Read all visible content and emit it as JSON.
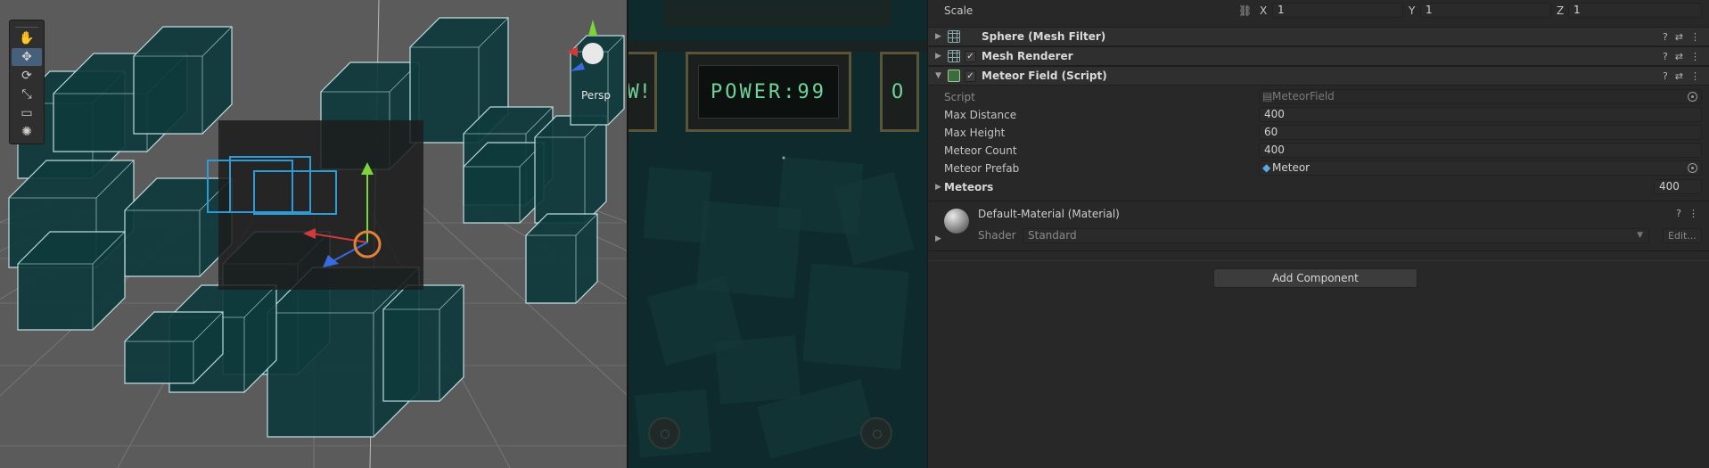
{
  "scene": {
    "tools": [
      {
        "name": "hand-tool-icon",
        "glyph": "✋"
      },
      {
        "name": "move-tool-icon",
        "glyph": "✥"
      },
      {
        "name": "rotate-tool-icon",
        "glyph": "⟳"
      },
      {
        "name": "scale-tool-icon",
        "glyph": "⤡"
      },
      {
        "name": "rect-tool-icon",
        "glyph": "▭"
      },
      {
        "name": "transform-tool-icon",
        "glyph": "✺"
      }
    ],
    "projection_label": "Persp",
    "colors": {
      "background": "#5b5b5b",
      "meteor_fill": "#0f3a3c",
      "meteor_edge": "#c9e8ec",
      "selection": "#2e9bd6"
    }
  },
  "game": {
    "hud_text": "POWER:99",
    "left_text": "W!",
    "right_text": "O",
    "colors": {
      "hud_text": "#6fd39b",
      "frame": "#5c5436",
      "background": "#0e2a2c"
    }
  },
  "inspector": {
    "scale": {
      "label": "Scale",
      "x_label": "X",
      "x": "1",
      "y_label": "Y",
      "y": "1",
      "z_label": "Z",
      "z": "1"
    },
    "components": [
      {
        "title": "Sphere (Mesh Filter)",
        "icon": "grid-icon",
        "checkbox": false
      },
      {
        "title": "Mesh Renderer",
        "icon": "grid-icon",
        "checkbox": true
      },
      {
        "title": "Meteor Field (Script)",
        "icon": "script-icon",
        "checkbox": true
      }
    ],
    "script": {
      "script_label": "Script",
      "script_value": "MeteorField",
      "max_distance_label": "Max Distance",
      "max_distance": "400",
      "max_height_label": "Max Height",
      "max_height": "60",
      "meteor_count_label": "Meteor Count",
      "meteor_count": "400",
      "meteor_prefab_label": "Meteor Prefab",
      "meteor_prefab": "Meteor",
      "meteors_label": "Meteors",
      "meteors_size": "400"
    },
    "material": {
      "title": "Default-Material (Material)",
      "shader_label": "Shader",
      "shader_value": "Standard",
      "edit_label": "Edit..."
    },
    "add_component": "Add Component"
  }
}
